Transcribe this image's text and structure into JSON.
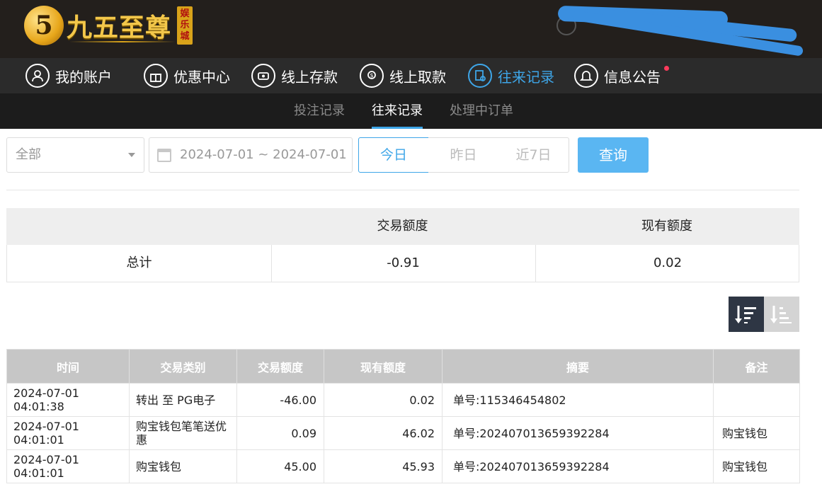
{
  "header": {
    "logo_mark": "5",
    "logo_text": "九五至尊",
    "logo_tag": "娱乐城"
  },
  "nav": [
    {
      "label": "我的账户",
      "icon": "user-icon"
    },
    {
      "label": "优惠中心",
      "icon": "gift-icon"
    },
    {
      "label": "线上存款",
      "icon": "deposit-icon"
    },
    {
      "label": "线上取款",
      "icon": "withdraw-icon"
    },
    {
      "label": "往来记录",
      "icon": "record-icon",
      "active": true
    },
    {
      "label": "信息公告",
      "icon": "bell-icon",
      "badge": true
    }
  ],
  "subnav": [
    {
      "label": "投注记录"
    },
    {
      "label": "往来记录",
      "active": true
    },
    {
      "label": "处理中订单"
    }
  ],
  "filters": {
    "type_select": "全部",
    "date_range": "2024-07-01 ~ 2024-07-01",
    "periods": [
      "今日",
      "昨日",
      "近7日"
    ],
    "active_period": "今日",
    "query_button": "查询"
  },
  "summary": {
    "headers": [
      "",
      "交易额度",
      "现有额度"
    ],
    "row": {
      "label": "总计",
      "trade_amount": "-0.91",
      "current_amount": "0.02"
    }
  },
  "records": {
    "headers": [
      "时间",
      "交易类别",
      "交易额度",
      "现有额度",
      "摘要",
      "备注"
    ],
    "rows": [
      {
        "time": "2024-07-01 04:01:38",
        "type": "转出 至 PG电子",
        "amount": "-46.00",
        "balance": "0.02",
        "summary": "单号:115346454802",
        "note": ""
      },
      {
        "time": "2024-07-01 04:01:01",
        "type": "购宝钱包笔笔送优惠",
        "amount": "0.09",
        "balance": "46.02",
        "summary": "单号:202407013659392284",
        "note": "购宝钱包"
      },
      {
        "time": "2024-07-01 04:01:01",
        "type": "购宝钱包",
        "amount": "45.00",
        "balance": "45.93",
        "summary": "单号:202407013659392284",
        "note": "购宝钱包"
      }
    ]
  },
  "colors": {
    "accent": "#3ea6e8",
    "header_bg": "#231f1c",
    "nav_bg": "#2b2b2b",
    "subnav_bg": "#1c1c1c",
    "query_btn": "#5ab6f2",
    "gold": "#f3c74a"
  }
}
